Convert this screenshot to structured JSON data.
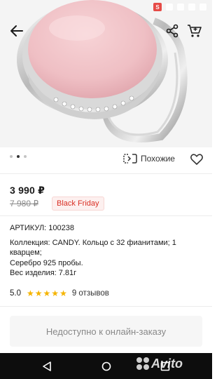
{
  "status_bar": {
    "red_badge": "S"
  },
  "top_nav": {
    "back_icon": "arrow-left-icon",
    "share_icon": "share-icon",
    "cart_icon": "shopping-cart-icon"
  },
  "gallery": {
    "total_images": 3,
    "active_index": 1
  },
  "similar": {
    "label": "Похожие",
    "icon": "similar-icon"
  },
  "favorite": {
    "icon": "heart-icon"
  },
  "price": {
    "current": "3 990 ₽",
    "old": "7 980 ₽",
    "badge": "Black Friday"
  },
  "details": {
    "sku": "АРТИКУЛ: 100238",
    "description_line1": "Коллекция: CANDY. Кольцо с 32 фианитами; 1",
    "description_line2": "кварцем;",
    "description_line3": "Серебро 925 пробы.",
    "description_line4": "Вес изделия: 7.81г"
  },
  "rating": {
    "value": "5.0",
    "stars": 5,
    "reviews": "9 отзывов"
  },
  "unavailable_label": "Недоступно к онлайн-заказу",
  "watermark": "Avito",
  "colors": {
    "accent": "#d93025",
    "star": "#f5b400",
    "stone": "#f2c3c6"
  }
}
